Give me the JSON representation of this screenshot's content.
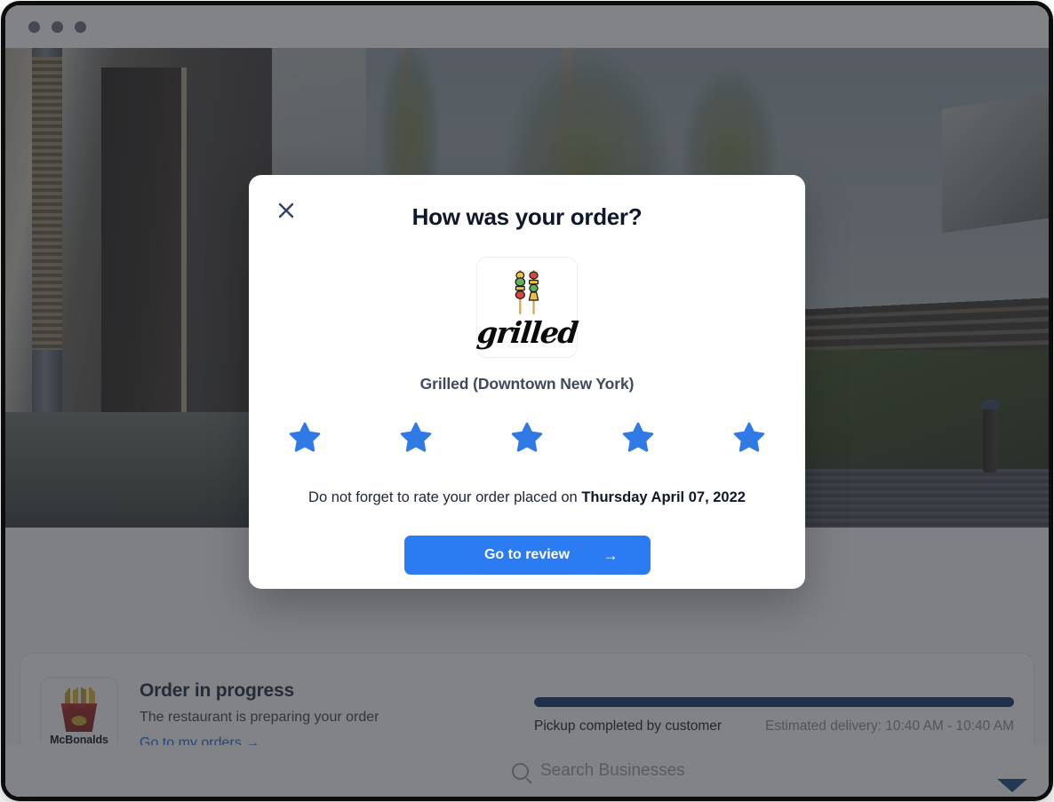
{
  "window": {
    "traffic_lights": [
      "close-dot",
      "minimize-dot",
      "maximize-dot"
    ]
  },
  "modal": {
    "title": "How was your order?",
    "close_icon": "close-icon",
    "merchant": {
      "logo_word": "grilled",
      "logo_icon": "skewer-logo-icon",
      "name": "Grilled (Downtown New York)"
    },
    "rating": {
      "max": 5,
      "selected": 5,
      "star_icon": "star-icon",
      "star_color": "#2f7ae5"
    },
    "note_prefix": "Do not forget to rate your order placed on ",
    "note_date": "Thursday April 07, 2022",
    "cta_label": "Go to review",
    "cta_arrow": "→",
    "cta_color": "#2b7cf3"
  },
  "order_card": {
    "brand_name": "McBonalds",
    "brand_icon": "fries-icon",
    "title": "Order in progress",
    "subtitle": "The restaurant is preparing your order",
    "link_label": "Go to my orders →",
    "link_color": "#2b6cd4",
    "progress": {
      "percent": 100,
      "fill_color": "#123a73",
      "status": "Pickup completed by customer",
      "eta": "Estimated delivery: 10:40 AM - 10:40 AM"
    }
  },
  "search": {
    "placeholder": "Search Businesses",
    "icon": "search-icon"
  },
  "footer": {
    "filter_icon": "filter-triangle-icon",
    "filter_color": "#1d4f86"
  }
}
